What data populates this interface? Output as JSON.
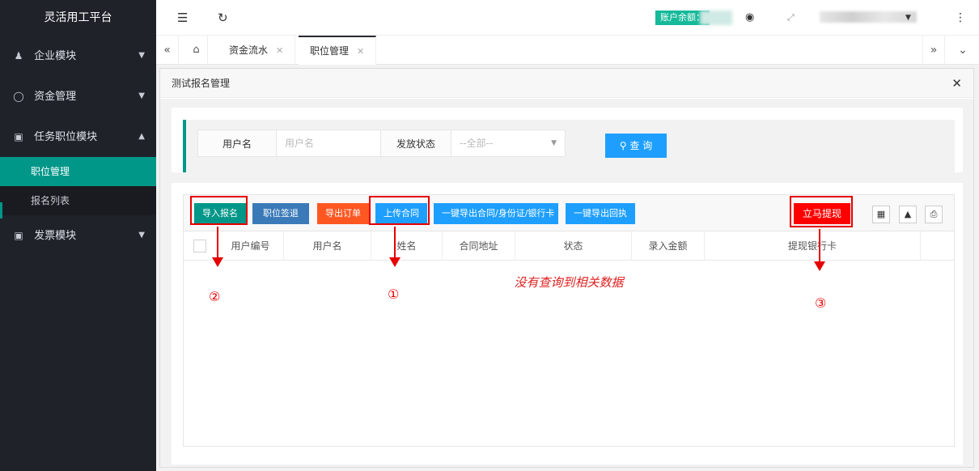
{
  "sidebar": {
    "logo": "灵活用工平台",
    "menus": [
      {
        "label": "企业模块",
        "icon": "user-group-icon"
      },
      {
        "label": "资金管理",
        "icon": "yen-icon"
      },
      {
        "label": "任务职位模块",
        "icon": "task-icon"
      },
      {
        "label": "发票模块",
        "icon": "invoice-icon"
      }
    ],
    "submenu": [
      {
        "label": "职位管理"
      },
      {
        "label": "报名列表"
      }
    ]
  },
  "topbar": {
    "balance_label": "账户余额："
  },
  "tabs": {
    "items": [
      {
        "label": "资金流水"
      },
      {
        "label": "职位管理"
      }
    ]
  },
  "panel": {
    "title": "测试报名管理"
  },
  "search": {
    "username_label": "用户名",
    "username_placeholder": "用户名",
    "status_label": "发放状态",
    "status_value": "--全部--",
    "query_button": "查 询"
  },
  "toolbar": {
    "import_signup": "导入报名",
    "position_sign_return": "职位签退",
    "export_order": "导出订单",
    "upload_contract": "上传合同",
    "export_contract_id_bank": "一键导出合同/身份证/银行卡",
    "export_receipt": "一键导出回执",
    "withdraw_now": "立马提现"
  },
  "table": {
    "columns": [
      "用户编号",
      "用户名",
      "姓名",
      "合同地址",
      "状态",
      "录入金额",
      "提现银行卡"
    ],
    "empty_message": "没有查询到相关数据"
  },
  "annotations": {
    "labels": [
      "①",
      "②",
      "③"
    ],
    "color": "#e60000"
  },
  "colors": {
    "accent": "#009688",
    "primary": "#1e9fff",
    "danger": "#ff0000",
    "sidebar": "#20222a"
  }
}
